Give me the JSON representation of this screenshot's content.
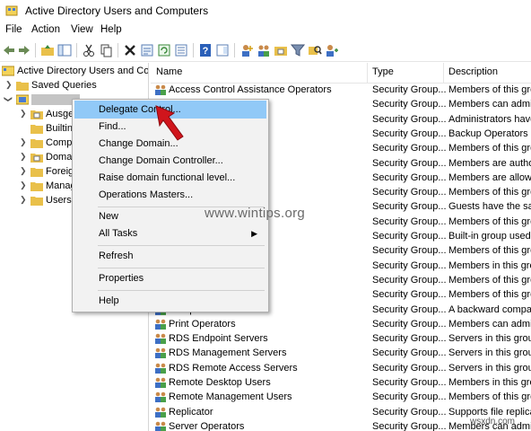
{
  "window": {
    "title": "Active Directory Users and Computers"
  },
  "menu": [
    "File",
    "Action",
    "View",
    "Help"
  ],
  "tree": {
    "root": "Active Directory Users and Com",
    "saved_queries": "Saved Queries",
    "domain": "",
    "children": [
      "Ausge",
      "Builtin",
      "Comp",
      "Doma",
      "Foreign",
      "Manag",
      "Users"
    ]
  },
  "list": {
    "headers": {
      "name": "Name",
      "type": "Type",
      "description": "Description"
    },
    "rows": [
      {
        "name": "Access Control Assistance Operators",
        "type": "Security Group...",
        "desc": "Members of this gro"
      },
      {
        "name": "",
        "type": "Security Group...",
        "desc": "Members can admin"
      },
      {
        "name": "",
        "type": "Security Group...",
        "desc": "Administrators have"
      },
      {
        "name": "",
        "type": "Security Group...",
        "desc": "Backup Operators ca"
      },
      {
        "name": "M Access",
        "type": "Security Group...",
        "desc": "Members of this gro"
      },
      {
        "name": "s",
        "type": "Security Group...",
        "desc": "Members are author"
      },
      {
        "name": "",
        "type": "Security Group...",
        "desc": "Members are allowe"
      },
      {
        "name": "",
        "type": "Security Group...",
        "desc": "Members of this gro"
      },
      {
        "name": "",
        "type": "Security Group...",
        "desc": "Guests have the sam"
      },
      {
        "name": "",
        "type": "Security Group...",
        "desc": "Members of this gro"
      },
      {
        "name": "",
        "type": "Security Group...",
        "desc": "Built-in group used"
      },
      {
        "name": "uilders",
        "type": "Security Group...",
        "desc": "Members of this gro"
      },
      {
        "name": "Operators",
        "type": "Security Group...",
        "desc": "Members in this gro"
      },
      {
        "name": "",
        "type": "Security Group...",
        "desc": "Members of this gro"
      },
      {
        "name": "sers",
        "type": "Security Group...",
        "desc": "Members of this gro"
      },
      {
        "name": "Compatible Access",
        "type": "Security Group...",
        "desc": "A backward compat"
      },
      {
        "name": "Print Operators",
        "type": "Security Group...",
        "desc": "Members can admin"
      },
      {
        "name": "RDS Endpoint Servers",
        "type": "Security Group...",
        "desc": "Servers in this group"
      },
      {
        "name": "RDS Management Servers",
        "type": "Security Group...",
        "desc": "Servers in this group"
      },
      {
        "name": "RDS Remote Access Servers",
        "type": "Security Group...",
        "desc": "Servers in this group"
      },
      {
        "name": "Remote Desktop Users",
        "type": "Security Group...",
        "desc": "Members in this gro"
      },
      {
        "name": "Remote Management Users",
        "type": "Security Group...",
        "desc": "Members of this gro"
      },
      {
        "name": "Replicator",
        "type": "Security Group...",
        "desc": "Supports file replicat"
      },
      {
        "name": "Server Operators",
        "type": "Security Group...",
        "desc": "Members can admin"
      }
    ]
  },
  "context_menu": {
    "items": [
      {
        "label": "Delegate Control...",
        "highlighted": true
      },
      {
        "label": "Find..."
      },
      {
        "label": "Change Domain..."
      },
      {
        "label": "Change Domain Controller..."
      },
      {
        "label": "Raise domain functional level..."
      },
      {
        "label": "Operations Masters..."
      },
      {
        "label": "New"
      },
      {
        "label": "All Tasks",
        "submenu": true
      },
      {
        "label": "Refresh"
      },
      {
        "label": "Properties"
      },
      {
        "label": "Help"
      }
    ]
  },
  "watermark": "www.wintips.org",
  "corner_mark": "wsxdn.com",
  "colors": {
    "highlight": "#91c9f7",
    "pointer": "#d0151c",
    "folder": "#e9c04a"
  }
}
